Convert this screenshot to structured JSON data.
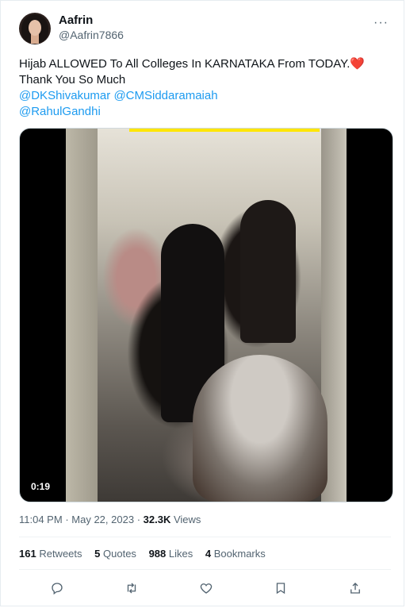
{
  "author": {
    "name": "Aafrin",
    "handle": "@Aafrin7866"
  },
  "tweet": {
    "line1": "Hijab ALLOWED To All Colleges In KARNATAKA From TODAY.",
    "heart": "❤️",
    "line2": "Thank You So Much",
    "mention1": "@DKShivakumar",
    "mention2": "@CMSiddaramaiah",
    "mention3": "@RahulGandhi"
  },
  "media": {
    "duration": "0:19"
  },
  "meta": {
    "time": "11:04 PM",
    "separator": "·",
    "date": "May 22, 2023",
    "views_count": "32.3K",
    "views_label": "Views"
  },
  "stats": {
    "retweets_count": "161",
    "retweets_label": "Retweets",
    "quotes_count": "5",
    "quotes_label": "Quotes",
    "likes_count": "988",
    "likes_label": "Likes",
    "bookmarks_count": "4",
    "bookmarks_label": "Bookmarks"
  },
  "more_glyph": "···",
  "icons": {
    "reply": "reply-icon",
    "retweet": "retweet-icon",
    "like": "heart-icon",
    "bookmark": "bookmark-icon",
    "share": "share-icon"
  },
  "colors": {
    "accent": "#1d9bf0",
    "heart": "#e0245e",
    "secondary_text": "#536471"
  }
}
